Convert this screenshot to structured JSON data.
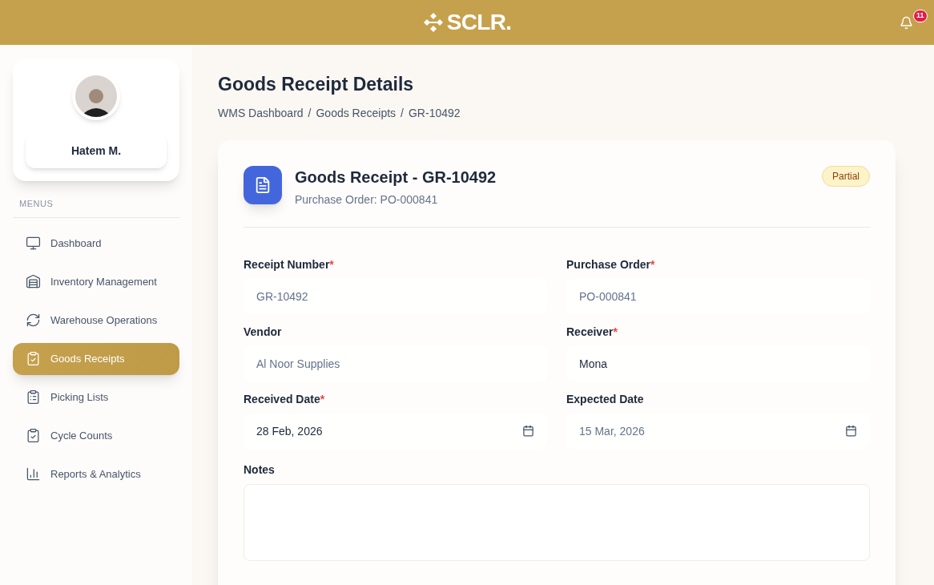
{
  "header": {
    "logo": "SCLR.",
    "notifications": {
      "count": "11"
    }
  },
  "sidebar": {
    "user": {
      "name": "Hatem M."
    },
    "section": "MENUS",
    "items": [
      {
        "label": "Dashboard",
        "kind": "monitor",
        "selected": false
      },
      {
        "label": "Inventory Management",
        "kind": "warehouse",
        "selected": false
      },
      {
        "label": "Warehouse Operations",
        "kind": "refresh",
        "selected": false
      },
      {
        "label": "Goods Receipts",
        "kind": "clipboard",
        "selected": true
      },
      {
        "label": "Picking Lists",
        "kind": "list",
        "selected": false
      },
      {
        "label": "Cycle Counts",
        "kind": "clipboard",
        "selected": false
      },
      {
        "label": "Reports & Analytics",
        "kind": "chart",
        "selected": false
      }
    ]
  },
  "page": {
    "title": "Goods Receipt Details",
    "breadcrumb": [
      "WMS Dashboard",
      "Goods Receipts",
      "GR-10492"
    ],
    "breadcrumb_separator": "/"
  },
  "card": {
    "title": "Goods Receipt - GR-10492",
    "subtitle": "Purchase Order: PO-000841",
    "status": "Partial",
    "required_mark": "*",
    "fields": [
      {
        "label": "Receipt Number",
        "required": true,
        "kind": "text",
        "value": "GR-10492",
        "disabled": true
      },
      {
        "label": "Purchase Order",
        "required": true,
        "kind": "text",
        "value": "PO-000841",
        "disabled": true
      },
      {
        "label": "Vendor",
        "required": false,
        "kind": "text",
        "value": "Al Noor Supplies",
        "disabled": true
      },
      {
        "label": "Receiver",
        "required": true,
        "kind": "text",
        "value": "Mona",
        "disabled": false
      },
      {
        "label": "Received Date",
        "required": true,
        "kind": "date",
        "value": "28 Feb, 2026",
        "disabled": false
      },
      {
        "label": "Expected Date",
        "required": false,
        "kind": "date",
        "value": "15 Mar, 2026",
        "disabled": true
      }
    ],
    "notes": {
      "label": "Notes"
    }
  }
}
